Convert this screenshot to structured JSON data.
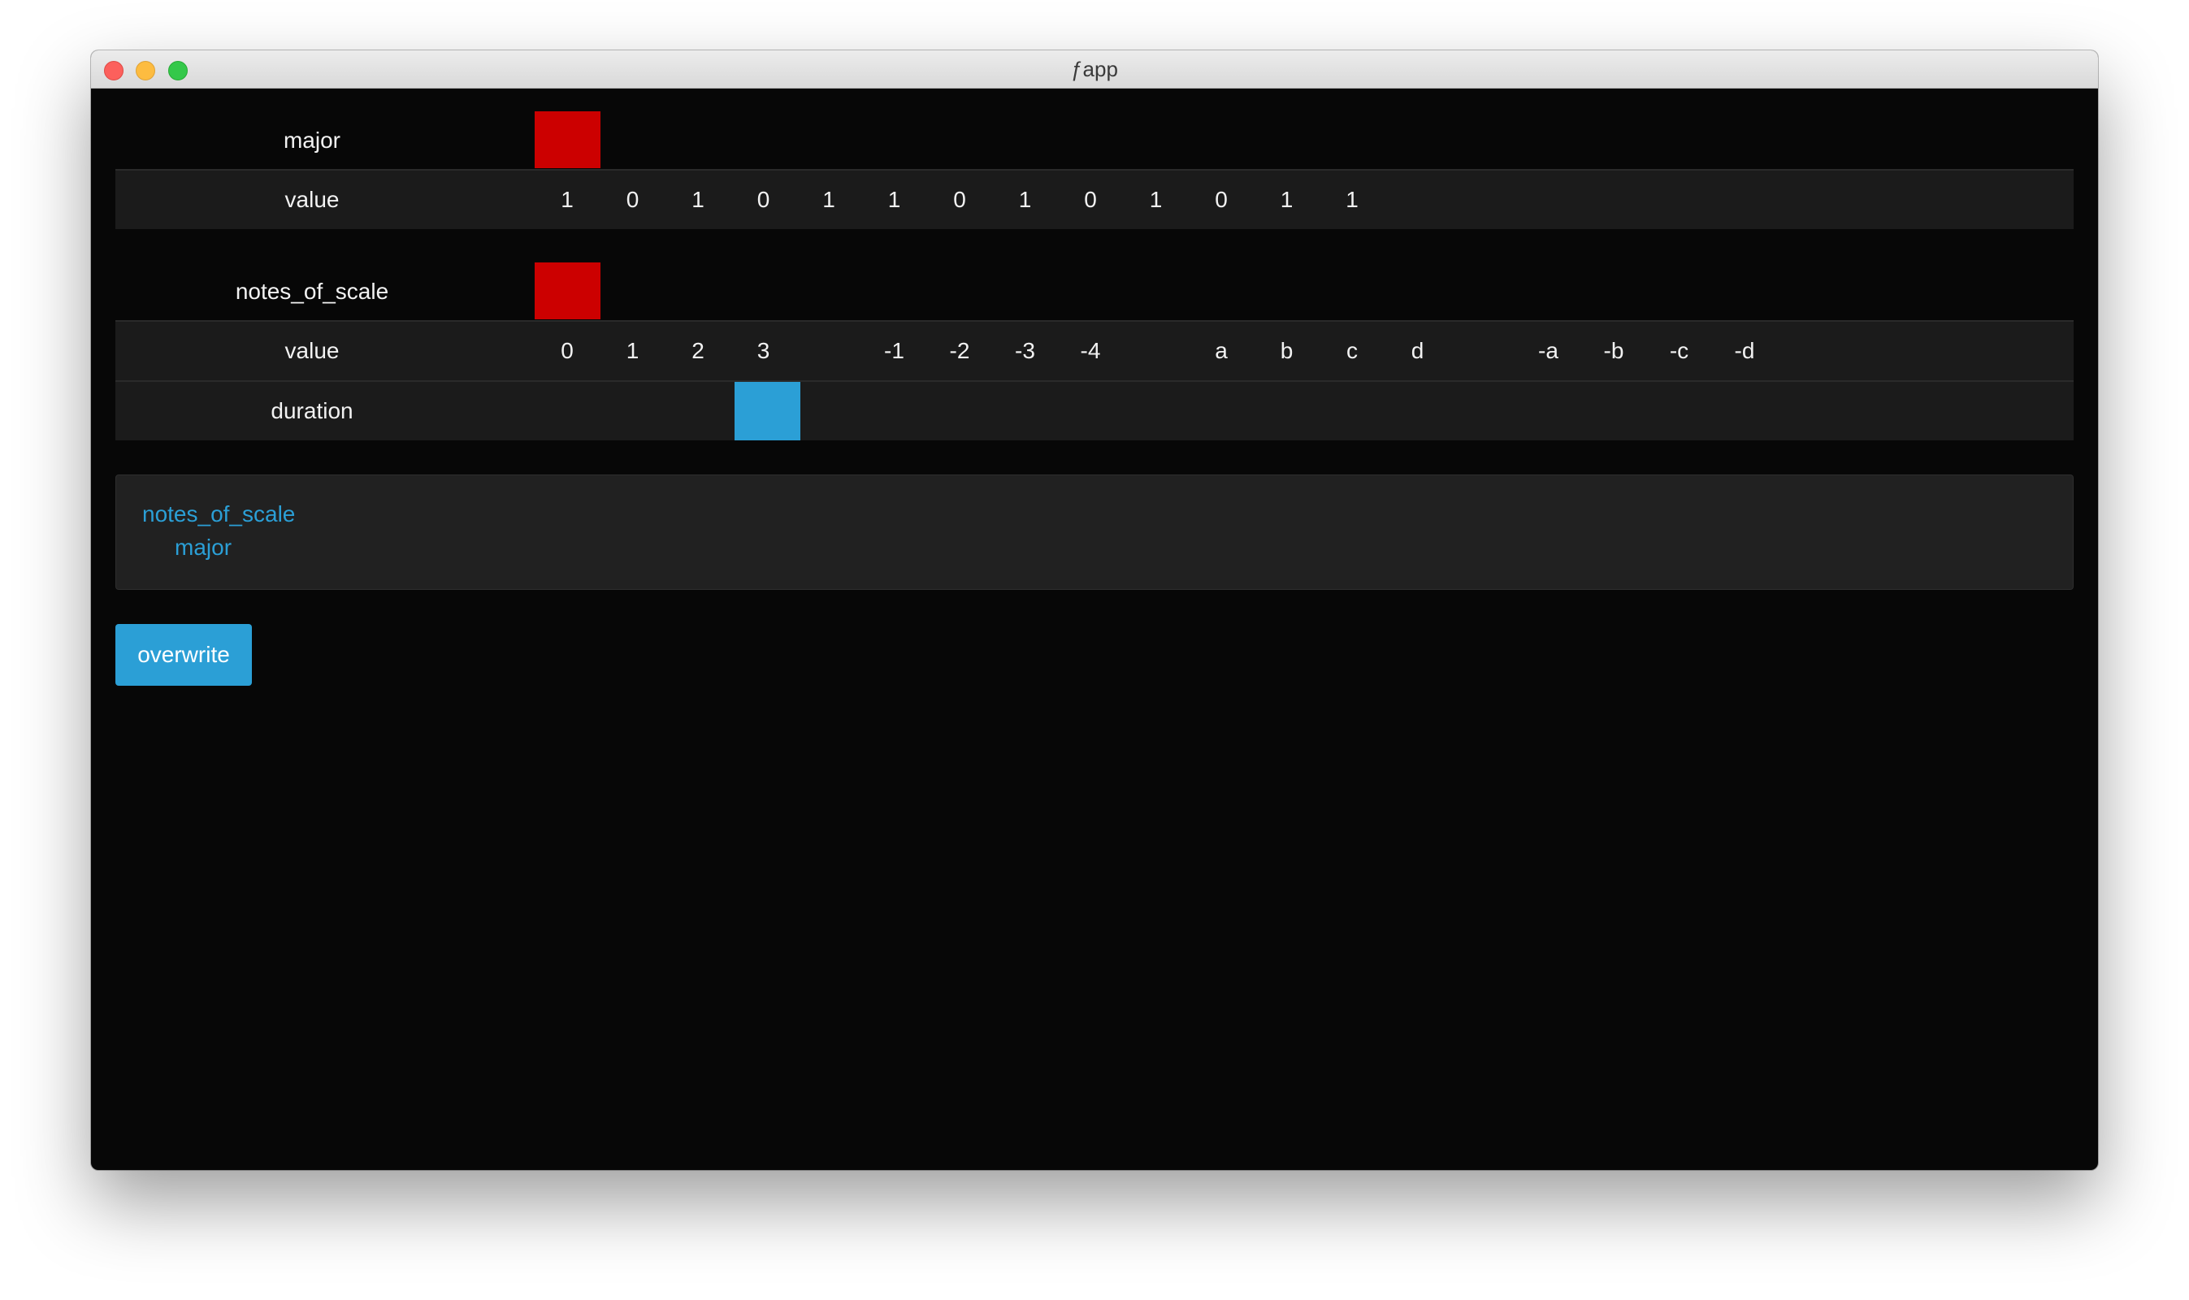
{
  "window": {
    "title": "ƒapp"
  },
  "rows": [
    {
      "label": "major",
      "kind": "selector",
      "cells": []
    },
    {
      "label": "value",
      "kind": "values",
      "cells": [
        "1",
        "0",
        "1",
        "0",
        "1",
        "1",
        "0",
        "1",
        "0",
        "1",
        "0",
        "1",
        "1"
      ]
    },
    {
      "label": "notes_of_scale",
      "kind": "selector",
      "cells": []
    },
    {
      "label": "value",
      "kind": "values",
      "cells": [
        "0",
        "1",
        "2",
        "3",
        "",
        "-1",
        "-2",
        "-3",
        "-4",
        "",
        "a",
        "b",
        "c",
        "d",
        "",
        "-a",
        "-b",
        "-c",
        "-d"
      ]
    },
    {
      "label": "duration",
      "kind": "selector",
      "cells": []
    }
  ],
  "path_panel": {
    "items": [
      "notes_of_scale",
      "major"
    ]
  },
  "actions": {
    "overwrite_label": "overwrite"
  },
  "colors": {
    "selection_red": "#cc0000",
    "selection_blue": "#2b9fd6",
    "link": "#2b9fd6",
    "background": "#070707"
  }
}
